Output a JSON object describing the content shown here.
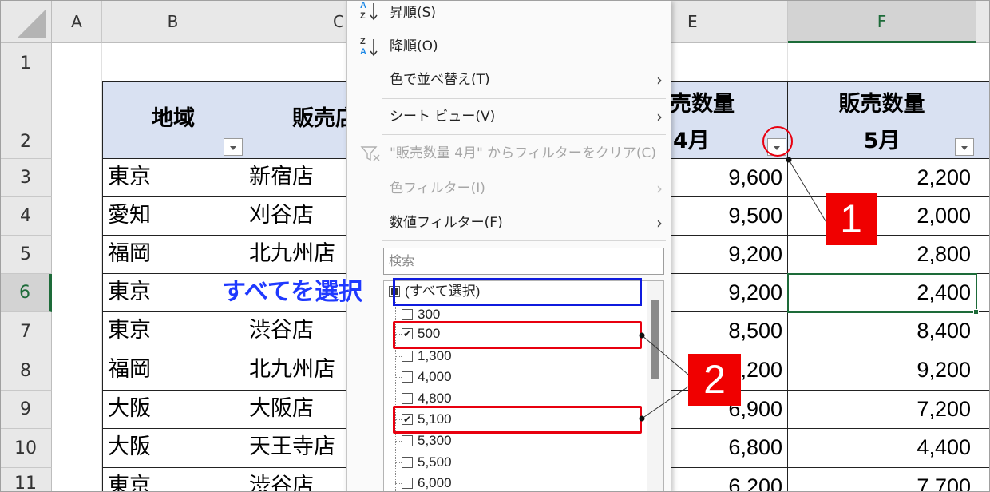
{
  "column_headers": [
    "A",
    "B",
    "C",
    "E",
    "F"
  ],
  "row_headers": [
    "1",
    "2",
    "3",
    "4",
    "5",
    "6",
    "7",
    "8",
    "9",
    "10",
    "11"
  ],
  "table": {
    "headers": {
      "region": "地域",
      "store_partial": "販売店",
      "e_line1": "売数量",
      "e_line2": "4月",
      "f_line1": "販売数量",
      "f_line2": "5月"
    },
    "rows": [
      {
        "region": "東京",
        "store": "新宿店",
        "e": "9,600",
        "f": "2,200"
      },
      {
        "region": "愛知",
        "store": "刈谷店",
        "e": "9,500",
        "f": "2,000"
      },
      {
        "region": "福岡",
        "store": "北九州店",
        "e": "9,200",
        "f": "2,800"
      },
      {
        "region": "東京",
        "store": "",
        "e": "9,200",
        "f": "2,400"
      },
      {
        "region": "東京",
        "store": "渋谷店",
        "e": "8,500",
        "f": "8,400"
      },
      {
        "region": "福岡",
        "store": "北九州店",
        "e": "9,200",
        "f": "9,200"
      },
      {
        "region": "大阪",
        "store": "大阪店",
        "e": "6,900",
        "f": "7,200"
      },
      {
        "region": "大阪",
        "store": "天王寺店",
        "e": "6,800",
        "f": "4,400"
      },
      {
        "region": "東京",
        "store": "渋谷店",
        "e": "6,200",
        "f": "7,700"
      }
    ]
  },
  "menu": {
    "sort_asc": "昇順(S)",
    "sort_desc": "降順(O)",
    "sort_by_color": "色で並べ替え(T)",
    "sheet_view": "シート ビュー(V)",
    "clear_filter": "\"販売数量 4月\" からフィルターをクリア(C)",
    "color_filter": "色フィルター(I)",
    "number_filter": "数値フィルター(F)",
    "search_placeholder": "検索",
    "list": [
      {
        "label": "(すべて選択)",
        "state": "mixed"
      },
      {
        "label": "300",
        "state": "unchecked"
      },
      {
        "label": "500",
        "state": "checked"
      },
      {
        "label": "1,300",
        "state": "unchecked"
      },
      {
        "label": "4,000",
        "state": "unchecked"
      },
      {
        "label": "4,800",
        "state": "unchecked"
      },
      {
        "label": "5,100",
        "state": "checked"
      },
      {
        "label": "5,300",
        "state": "unchecked"
      },
      {
        "label": "5,500",
        "state": "unchecked"
      },
      {
        "label": "6,000",
        "state": "unchecked"
      }
    ]
  },
  "annotations": {
    "select_all_label": "すべてを選択",
    "badge1": "1",
    "badge2": "2"
  },
  "colors": {
    "header_fill": "#d9e1f2",
    "excel_green": "#1d6b39",
    "annotation_red": "#e8000f",
    "annotation_blue": "#0f1bde"
  },
  "icons": [
    "sort-ascending-icon",
    "sort-descending-icon",
    "clear-filter-icon",
    "submenu-arrow-icon",
    "filter-dropdown-icon",
    "select-all-corner-icon"
  ]
}
